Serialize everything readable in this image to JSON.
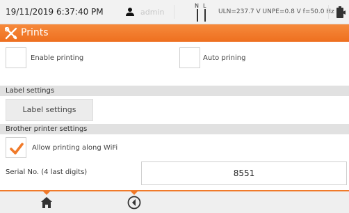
{
  "status": {
    "datetime": "19/11/2019 6:37:40 PM",
    "user": "admin",
    "nl_n": "N",
    "nl_l": "L",
    "measurements": "ULN=237.7 V UNPE=0.8 V f=50.0 Hz"
  },
  "title": {
    "text": "Prints",
    "icon": "tools-icon"
  },
  "options": {
    "enable_printing": {
      "label": "Enable printing",
      "checked": false
    },
    "auto_printing": {
      "label": "Auto prining",
      "checked": false
    }
  },
  "label_section": {
    "header": "Label settings",
    "button": "Label settings"
  },
  "brother_section": {
    "header": "Brother printer settings",
    "wifi": {
      "label": "Allow printing along WiFi",
      "checked": true
    }
  },
  "serial": {
    "label": "Serial No. (4 last digits)",
    "value": "8551"
  },
  "colors": {
    "accent": "#f07a2a",
    "checkmark": "#f07a2a"
  },
  "footer": {
    "icons": [
      "home-icon",
      "back-icon"
    ]
  }
}
